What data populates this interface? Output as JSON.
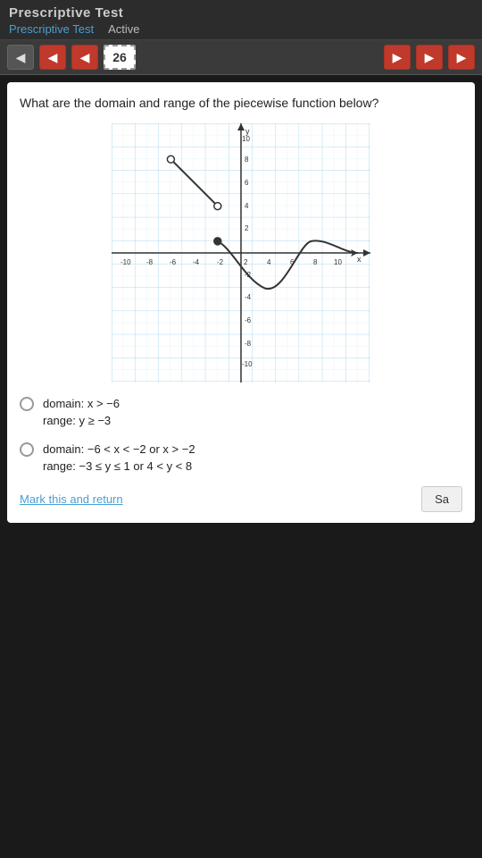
{
  "topBar": {
    "title": "Prescriptive Test",
    "breadcrumb": "Prescriptive Test",
    "status": "Active"
  },
  "navBar": {
    "pageNumber": "26",
    "prevLabel": "◀",
    "backLabel": "◀",
    "backLabel2": "◀",
    "backLabel3": "◀"
  },
  "question": {
    "text": "What are the domain and range of the piecewise function below?"
  },
  "options": [
    {
      "id": "option-1",
      "line1": "domain: x > −6",
      "line2": "range: y ≥ −3"
    },
    {
      "id": "option-2",
      "line1": "domain: −6 < x < −2 or x > −2",
      "line2": "range: −3 ≤ y ≤ 1 or 4 < y < 8"
    }
  ],
  "footer": {
    "markReturn": "Mark this and return",
    "save": "Sa"
  }
}
